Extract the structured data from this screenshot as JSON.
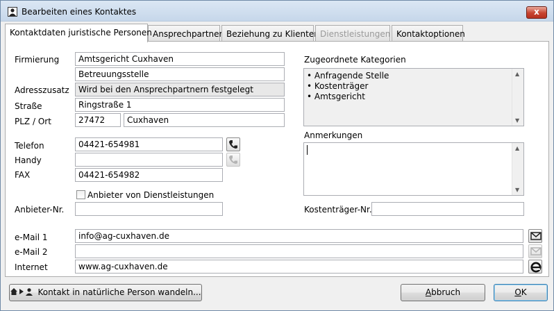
{
  "window": {
    "title": "Bearbeiten eines Kontaktes",
    "close_label": "x"
  },
  "tabs": [
    {
      "label": "Kontaktdaten juristische Personen",
      "active": true
    },
    {
      "label": "Ansprechpartner"
    },
    {
      "label": "Beziehung zu Klienten"
    },
    {
      "label": "Dienstleistungen",
      "disabled": true
    },
    {
      "label": "Kontaktoptionen"
    }
  ],
  "form": {
    "firmierung_label": "Firmierung",
    "firmierung1": "Amtsgericht Cuxhaven",
    "firmierung2": "Betreuungsstelle",
    "adresszusatz_label": "Adresszusatz",
    "adresszusatz": "Wird bei den Ansprechpartnern festgelegt",
    "strasse_label": "Straße",
    "strasse": "Ringstraße 1",
    "plz_ort_label": "PLZ / Ort",
    "plz": "27472",
    "ort": "Cuxhaven",
    "telefon_label": "Telefon",
    "telefon": "04421-654981",
    "handy_label": "Handy",
    "handy": "",
    "fax_label": "FAX",
    "fax": "04421-654982",
    "anbieter_checkbox_label": "Anbieter von Dienstleistungen",
    "anbieter_nr_label": "Anbieter-Nr.",
    "anbieter_nr": "",
    "kategorien_label": "Zugeordnete Kategorien",
    "kategorien": [
      "Anfragende Stelle",
      "Kostenträger",
      "Amtsgericht"
    ],
    "anmerkungen_label": "Anmerkungen",
    "anmerkungen": "",
    "kostentraeger_label": "Kostenträger-Nr.",
    "kostentraeger": "",
    "email1_label": "e-Mail 1",
    "email1": "info@ag-cuxhaven.de",
    "email2_label": "e-Mail 2",
    "email2": "",
    "internet_label": "Internet",
    "internet": "www.ag-cuxhaven.de"
  },
  "footer": {
    "convert_label": "Kontakt in natürliche Person wandeln...",
    "cancel_hotkey": "A",
    "cancel_rest": "bbruch",
    "ok_hotkey": "O",
    "ok_rest": "K"
  }
}
